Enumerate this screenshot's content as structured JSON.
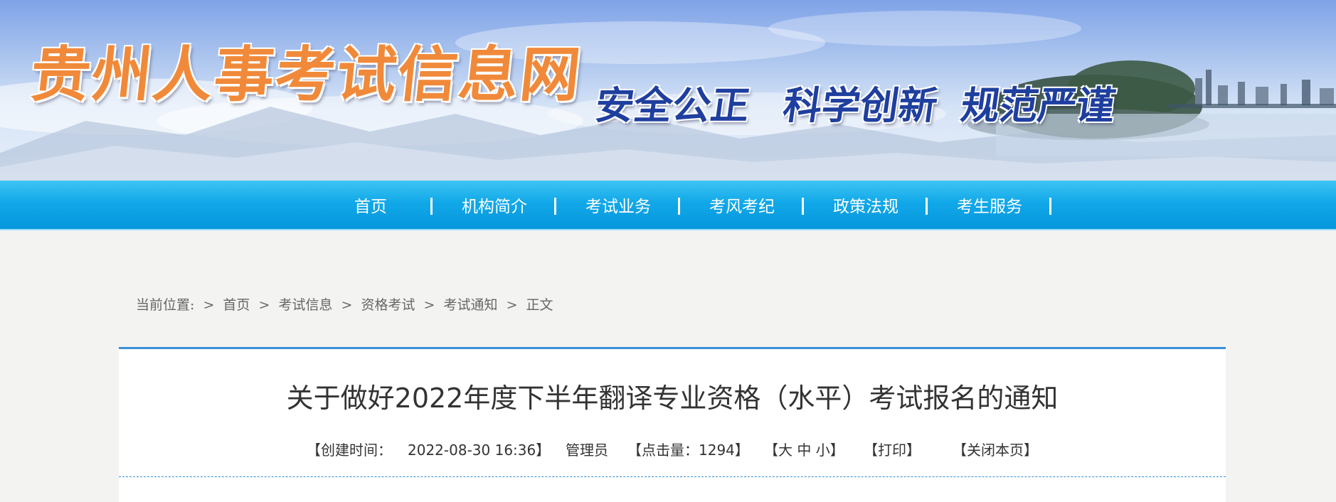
{
  "header": {
    "site_title": "贵州人事考试信息网",
    "slogan": [
      "安全公正",
      "科学创新",
      "规范严谨"
    ]
  },
  "nav": {
    "items": [
      {
        "label": "首页"
      },
      {
        "label": "机构简介"
      },
      {
        "label": "考试业务"
      },
      {
        "label": "考风考纪"
      },
      {
        "label": "政策法规"
      },
      {
        "label": "考生服务"
      }
    ]
  },
  "breadcrumb": {
    "label": "当前位置:",
    "separator": ">",
    "items": [
      "首页",
      "考试信息",
      "资格考试",
      "考试通知",
      "正文"
    ]
  },
  "article": {
    "title": "关于做好2022年度下半年翻译专业资格（水平）考试报名的通知",
    "meta": {
      "created_label": "【创建时间：",
      "created_value": "2022-08-30 16:36】",
      "author": "管理员",
      "hits": "【点击量：1294】",
      "font_size": "【大 中 小】",
      "print": "【打印】",
      "close": "【关闭本页】"
    }
  },
  "colors": {
    "nav_blue": "#0fa6e8",
    "accent_line": "#3a8fd8",
    "title_orange": "#f08a3a",
    "slogan_blue": "#1f3f9f",
    "page_bg": "#f3f3f1"
  }
}
